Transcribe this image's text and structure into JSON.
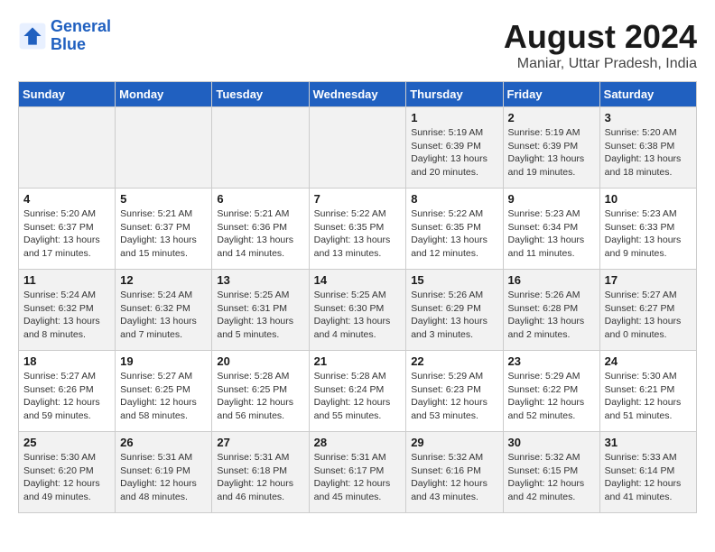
{
  "logo": {
    "line1": "General",
    "line2": "Blue"
  },
  "title": "August 2024",
  "subtitle": "Maniar, Uttar Pradesh, India",
  "weekdays": [
    "Sunday",
    "Monday",
    "Tuesday",
    "Wednesday",
    "Thursday",
    "Friday",
    "Saturday"
  ],
  "weeks": [
    [
      {
        "day": "",
        "info": ""
      },
      {
        "day": "",
        "info": ""
      },
      {
        "day": "",
        "info": ""
      },
      {
        "day": "",
        "info": ""
      },
      {
        "day": "1",
        "info": "Sunrise: 5:19 AM\nSunset: 6:39 PM\nDaylight: 13 hours\nand 20 minutes."
      },
      {
        "day": "2",
        "info": "Sunrise: 5:19 AM\nSunset: 6:39 PM\nDaylight: 13 hours\nand 19 minutes."
      },
      {
        "day": "3",
        "info": "Sunrise: 5:20 AM\nSunset: 6:38 PM\nDaylight: 13 hours\nand 18 minutes."
      }
    ],
    [
      {
        "day": "4",
        "info": "Sunrise: 5:20 AM\nSunset: 6:37 PM\nDaylight: 13 hours\nand 17 minutes."
      },
      {
        "day": "5",
        "info": "Sunrise: 5:21 AM\nSunset: 6:37 PM\nDaylight: 13 hours\nand 15 minutes."
      },
      {
        "day": "6",
        "info": "Sunrise: 5:21 AM\nSunset: 6:36 PM\nDaylight: 13 hours\nand 14 minutes."
      },
      {
        "day": "7",
        "info": "Sunrise: 5:22 AM\nSunset: 6:35 PM\nDaylight: 13 hours\nand 13 minutes."
      },
      {
        "day": "8",
        "info": "Sunrise: 5:22 AM\nSunset: 6:35 PM\nDaylight: 13 hours\nand 12 minutes."
      },
      {
        "day": "9",
        "info": "Sunrise: 5:23 AM\nSunset: 6:34 PM\nDaylight: 13 hours\nand 11 minutes."
      },
      {
        "day": "10",
        "info": "Sunrise: 5:23 AM\nSunset: 6:33 PM\nDaylight: 13 hours\nand 9 minutes."
      }
    ],
    [
      {
        "day": "11",
        "info": "Sunrise: 5:24 AM\nSunset: 6:32 PM\nDaylight: 13 hours\nand 8 minutes."
      },
      {
        "day": "12",
        "info": "Sunrise: 5:24 AM\nSunset: 6:32 PM\nDaylight: 13 hours\nand 7 minutes."
      },
      {
        "day": "13",
        "info": "Sunrise: 5:25 AM\nSunset: 6:31 PM\nDaylight: 13 hours\nand 5 minutes."
      },
      {
        "day": "14",
        "info": "Sunrise: 5:25 AM\nSunset: 6:30 PM\nDaylight: 13 hours\nand 4 minutes."
      },
      {
        "day": "15",
        "info": "Sunrise: 5:26 AM\nSunset: 6:29 PM\nDaylight: 13 hours\nand 3 minutes."
      },
      {
        "day": "16",
        "info": "Sunrise: 5:26 AM\nSunset: 6:28 PM\nDaylight: 13 hours\nand 2 minutes."
      },
      {
        "day": "17",
        "info": "Sunrise: 5:27 AM\nSunset: 6:27 PM\nDaylight: 13 hours\nand 0 minutes."
      }
    ],
    [
      {
        "day": "18",
        "info": "Sunrise: 5:27 AM\nSunset: 6:26 PM\nDaylight: 12 hours\nand 59 minutes."
      },
      {
        "day": "19",
        "info": "Sunrise: 5:27 AM\nSunset: 6:25 PM\nDaylight: 12 hours\nand 58 minutes."
      },
      {
        "day": "20",
        "info": "Sunrise: 5:28 AM\nSunset: 6:25 PM\nDaylight: 12 hours\nand 56 minutes."
      },
      {
        "day": "21",
        "info": "Sunrise: 5:28 AM\nSunset: 6:24 PM\nDaylight: 12 hours\nand 55 minutes."
      },
      {
        "day": "22",
        "info": "Sunrise: 5:29 AM\nSunset: 6:23 PM\nDaylight: 12 hours\nand 53 minutes."
      },
      {
        "day": "23",
        "info": "Sunrise: 5:29 AM\nSunset: 6:22 PM\nDaylight: 12 hours\nand 52 minutes."
      },
      {
        "day": "24",
        "info": "Sunrise: 5:30 AM\nSunset: 6:21 PM\nDaylight: 12 hours\nand 51 minutes."
      }
    ],
    [
      {
        "day": "25",
        "info": "Sunrise: 5:30 AM\nSunset: 6:20 PM\nDaylight: 12 hours\nand 49 minutes."
      },
      {
        "day": "26",
        "info": "Sunrise: 5:31 AM\nSunset: 6:19 PM\nDaylight: 12 hours\nand 48 minutes."
      },
      {
        "day": "27",
        "info": "Sunrise: 5:31 AM\nSunset: 6:18 PM\nDaylight: 12 hours\nand 46 minutes."
      },
      {
        "day": "28",
        "info": "Sunrise: 5:31 AM\nSunset: 6:17 PM\nDaylight: 12 hours\nand 45 minutes."
      },
      {
        "day": "29",
        "info": "Sunrise: 5:32 AM\nSunset: 6:16 PM\nDaylight: 12 hours\nand 43 minutes."
      },
      {
        "day": "30",
        "info": "Sunrise: 5:32 AM\nSunset: 6:15 PM\nDaylight: 12 hours\nand 42 minutes."
      },
      {
        "day": "31",
        "info": "Sunrise: 5:33 AM\nSunset: 6:14 PM\nDaylight: 12 hours\nand 41 minutes."
      }
    ]
  ]
}
